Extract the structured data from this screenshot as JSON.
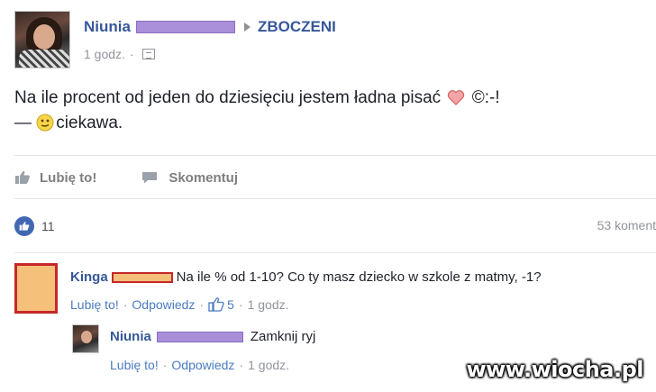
{
  "post": {
    "author": "Niunia",
    "group": "ZBOCZENI",
    "time": "1 godz.",
    "text_line1": "Na ile procent od jeden do dziesięciu jestem ładna pisać",
    "text_emoticon": "©:-!",
    "text_line2_prefix": "—",
    "text_line2": "ciekawa."
  },
  "actions": {
    "like_label": "Lubię to!",
    "comment_label": "Skomentuj"
  },
  "stats": {
    "likes": "11",
    "comments": "53 koment"
  },
  "comments": [
    {
      "author": "Kinga",
      "text": "Na ile % od 1-10? Co ty masz dziecko w szkole z matmy, -1?",
      "like_label": "Lubię to!",
      "reply_label": "Odpowiedz",
      "likes": "5",
      "time": "1 godz."
    },
    {
      "author": "Niunia",
      "text": "Zamknij ryj",
      "like_label": "Lubię to!",
      "reply_label": "Odpowiedz",
      "time": "1 godz."
    }
  ],
  "watermark": "www.wiocha.pl",
  "colors": {
    "link_blue": "#365899",
    "like_badge": "#4267b2",
    "redact_purple": "#a98fd9",
    "redact_red": "#c62828"
  }
}
